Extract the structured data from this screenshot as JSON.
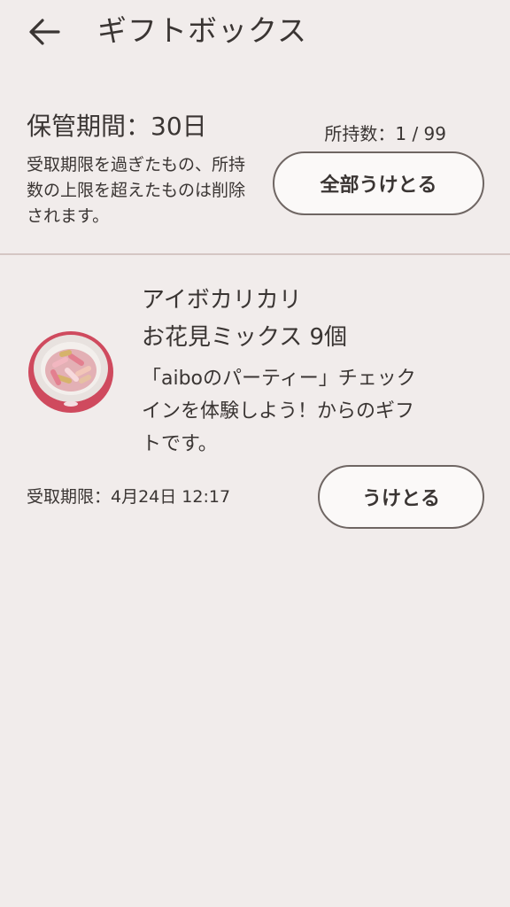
{
  "header": {
    "back_icon": "arrow-left-icon",
    "title": "ギフトボックス"
  },
  "storage": {
    "title": "保管期間：30日",
    "note": "受取期限を過ぎたもの、所持数の上限を超えたものは削除されます。",
    "count": "所持数：1 / 99",
    "receive_all_label": "全部うけとる"
  },
  "gift": {
    "icon": "food-bowl-icon",
    "name_line1": "アイボカリカリ",
    "name_line2": "お花見ミックス 9個",
    "desc_line1": "「aiboのパーティー」チェック",
    "desc_line2": "インを体験しよう！からのギフ",
    "desc_line3": "トです。",
    "expiry": "受取期限：4月24日 12:17",
    "receive_label": "うけとる"
  },
  "colors": {
    "background": "#f1eceb",
    "text": "#3a3533",
    "button_border": "#6f6663",
    "button_fill": "#fbf9f8",
    "divider": "#d5c6c3",
    "bowl_red": "#cf4a5e"
  }
}
